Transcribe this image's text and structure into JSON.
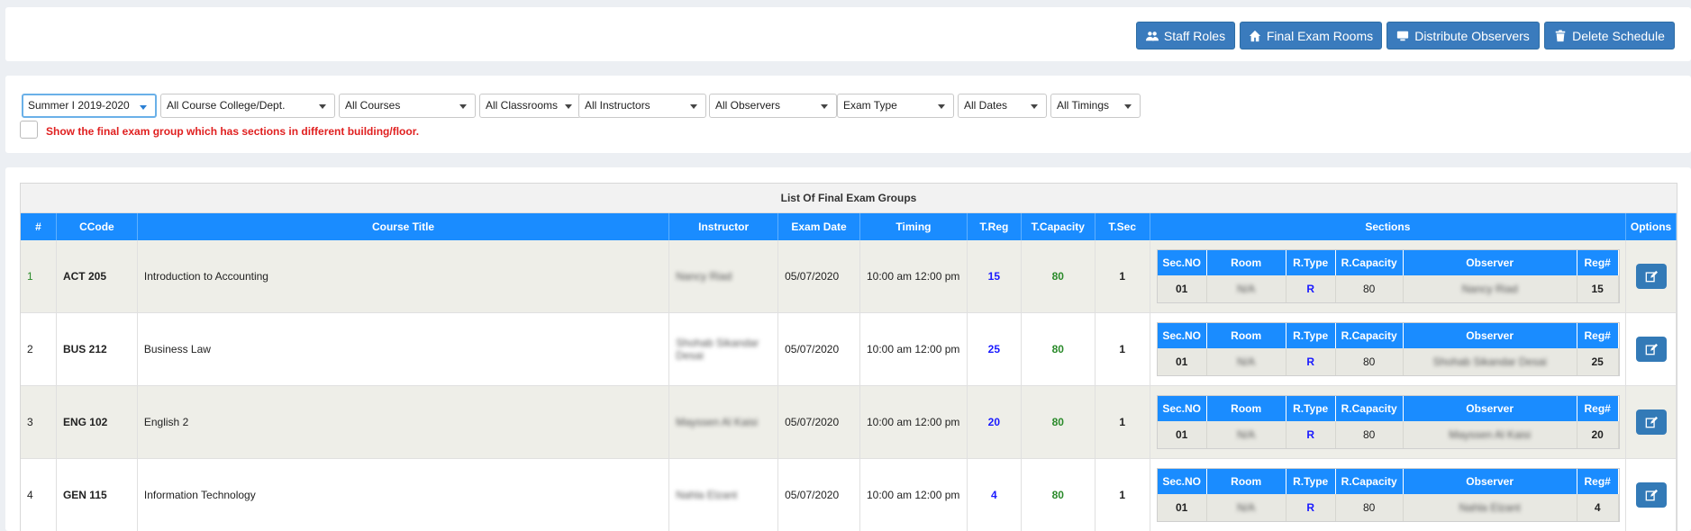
{
  "toolbar": {
    "staff_roles": "Staff Roles",
    "final_exam_rooms": "Final Exam Rooms",
    "distribute_observers": "Distribute Observers",
    "delete_schedule": "Delete Schedule"
  },
  "filters": {
    "semester": "Summer I 2019-2020",
    "college": "All Course College/Dept.",
    "courses": "All Courses",
    "classrooms": "All Classrooms",
    "instructors": "All Instructors",
    "observers": "All Observers",
    "exam_type": "Exam Type",
    "dates": "All Dates",
    "timings": "All Timings",
    "checkbox_label": "Show the final exam group which has sections in different building/floor."
  },
  "table": {
    "title": "List Of Final Exam Groups",
    "headers": [
      "#",
      "CCode",
      "Course Title",
      "Instructor",
      "Exam Date",
      "Timing",
      "T.Reg",
      "T.Capacity",
      "T.Sec",
      "Sections",
      "Options"
    ],
    "section_headers": [
      "Sec.NO",
      "Room",
      "R.Type",
      "R.Capacity",
      "Observer",
      "Reg#"
    ],
    "rows": [
      {
        "num": "1",
        "code": "ACT 205",
        "title": "Introduction to Accounting",
        "instructor": "Nancy Riad",
        "date": "05/07/2020",
        "timing": "10:00 am 12:00 pm",
        "treg": "15",
        "tcap": "80",
        "tsec": "1",
        "section": {
          "secno": "01",
          "room": "N/A",
          "rtype": "R",
          "rcap": "80",
          "observer": "Nancy Riad",
          "reg": "15"
        }
      },
      {
        "num": "2",
        "code": "BUS 212",
        "title": "Business Law",
        "instructor": "Shohab Sikandar Desai",
        "date": "05/07/2020",
        "timing": "10:00 am 12:00 pm",
        "treg": "25",
        "tcap": "80",
        "tsec": "1",
        "section": {
          "secno": "01",
          "room": "N/A",
          "rtype": "R",
          "rcap": "80",
          "observer": "Shohab Sikandar Desai",
          "reg": "25"
        }
      },
      {
        "num": "3",
        "code": "ENG 102",
        "title": "English 2",
        "instructor": "Mayssen Al Kaisi",
        "date": "05/07/2020",
        "timing": "10:00 am 12:00 pm",
        "treg": "20",
        "tcap": "80",
        "tsec": "1",
        "section": {
          "secno": "01",
          "room": "N/A",
          "rtype": "R",
          "rcap": "80",
          "observer": "Mayssen Al Kaisi",
          "reg": "20"
        }
      },
      {
        "num": "4",
        "code": "GEN 115",
        "title": "Information Technology",
        "instructor": "Nahla Elzant",
        "date": "05/07/2020",
        "timing": "10:00 am 12:00 pm",
        "treg": "4",
        "tcap": "80",
        "tsec": "1",
        "section": {
          "secno": "01",
          "room": "N/A",
          "rtype": "R",
          "rcap": "80",
          "observer": "Nahla Elzant",
          "reg": "4"
        }
      }
    ]
  }
}
